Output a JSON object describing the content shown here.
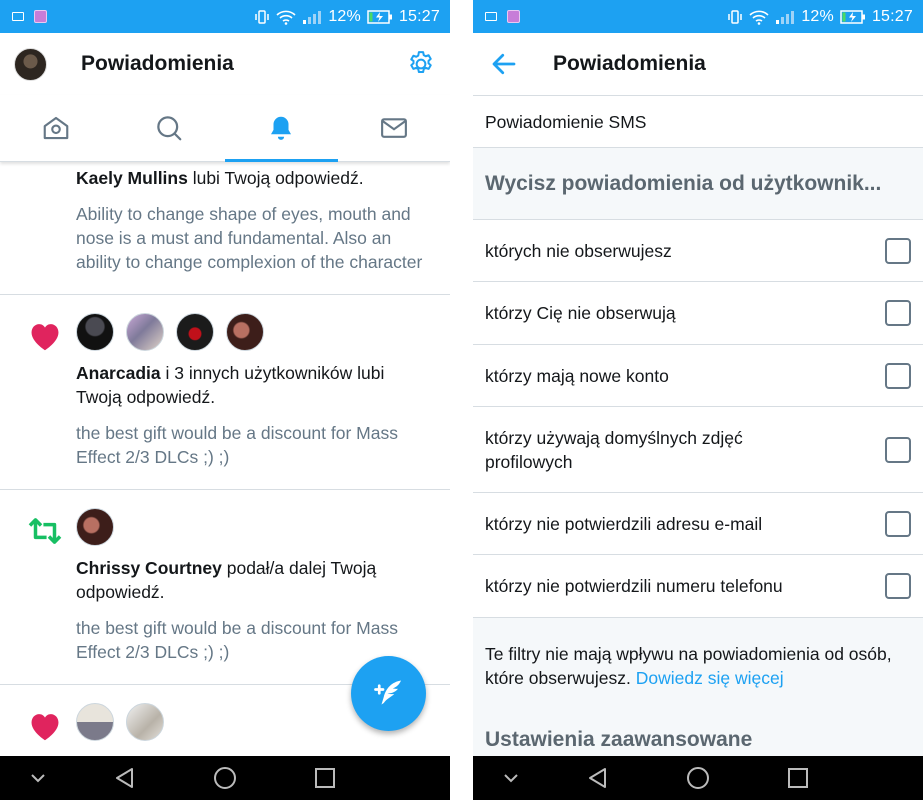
{
  "status_bar": {
    "battery": "12%",
    "time": "15:27"
  },
  "left": {
    "title": "Powiadomienia",
    "notifications": [
      {
        "user": "Kaely Mullins",
        "action": " lubi Twoją odpowiedź.",
        "text": "Ability to change shape of eyes, mouth and nose is a must and fundamental. Also an ability to change complexion of the character"
      },
      {
        "kind": "like",
        "user": "Anarcadia",
        "action": " i 3 innych użytkowników lubi Twoją odpowiedź.",
        "text": "the best gift would be a discount for Mass Effect 2/3 DLCs ;) ;)"
      },
      {
        "kind": "retweet",
        "user": "Chrissy Courtney",
        "action": " podał/a dalej Twoją odpowiedź.",
        "text": "the best gift would be a discount for Mass Effect 2/3 DLCs ;) ;)"
      },
      {
        "kind": "like"
      }
    ]
  },
  "right": {
    "title": "Powiadomienia",
    "sms_row": "Powiadomienie SMS",
    "section_title": "Wycisz powiadomienia od użytkownik...",
    "options": [
      "których nie obserwujesz",
      "którzy Cię nie obserwują",
      "którzy mają nowe konto",
      "którzy używają domyślnych zdjęć profilowych",
      "którzy nie potwierdzili adresu e-mail",
      "którzy nie potwierdzili numeru telefonu"
    ],
    "footer_text": "Te filtry nie mają wpływu na powiadomienia od osób, które obserwujesz. ",
    "footer_link": "Dowiedz się więcej",
    "next_section": "Ustawienia zaawansowane"
  },
  "colors": {
    "accent": "#1da1f2",
    "like": "#e0245e",
    "retweet": "#17bf63",
    "muted": "#657786"
  }
}
